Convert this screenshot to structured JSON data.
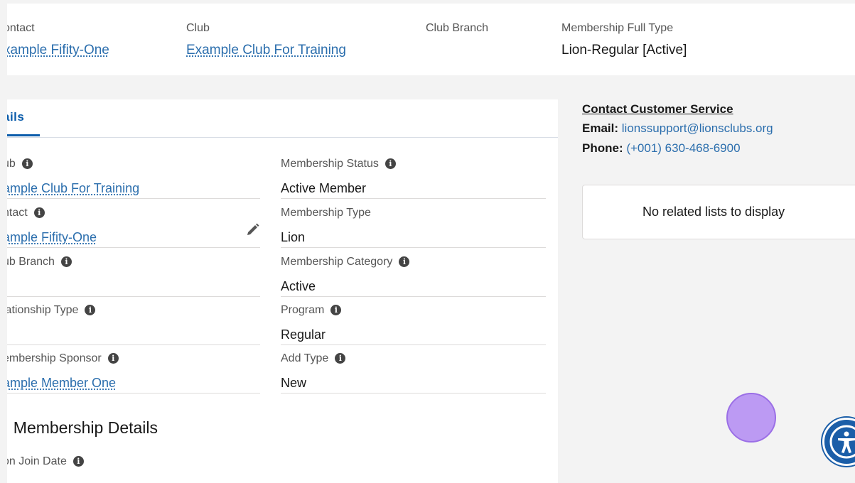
{
  "header": {
    "contact_label": "ontact",
    "contact_value": "xample Fifity-One",
    "club_label": "Club",
    "club_value": "Example Club For Training",
    "branch_label": "Club Branch",
    "fulltype_label": "Membership Full Type",
    "fulltype_value": "Lion-Regular [Active]"
  },
  "tabs": {
    "details": "ails"
  },
  "left_fields": [
    {
      "label": "ub",
      "value": "ample Club For Training",
      "has_info": true
    },
    {
      "label": "ntact",
      "value": "ample Fifity-One",
      "has_info": true
    },
    {
      "label": "ub Branch",
      "value": "",
      "has_info": true
    },
    {
      "label": "lationship Type",
      "value": "",
      "has_info": true
    },
    {
      "label": "embership Sponsor",
      "value": "ample Member One",
      "has_info": true
    }
  ],
  "right_fields": [
    {
      "label": "Membership Status",
      "value": "Active Member",
      "has_info": true
    },
    {
      "label": "Membership Type",
      "value": "Lion",
      "has_info": false
    },
    {
      "label": "Membership Category",
      "value": "Active",
      "has_info": true
    },
    {
      "label": "Program",
      "value": "Regular",
      "has_info": true
    },
    {
      "label": "Add Type",
      "value": "New",
      "has_info": true
    }
  ],
  "section": {
    "title": "Membership Details",
    "join_date_label": "on Join Date"
  },
  "sidebar": {
    "title": "Contact Customer Service",
    "email_label": "Email:",
    "email_value": "lionssupport@lionsclubs.org",
    "phone_label": "Phone:",
    "phone_value": "(+001) 630-468-6900",
    "related_empty": "No related lists to display"
  },
  "icons": {
    "info": "info-icon",
    "edit": "pencil-icon",
    "accessibility": "accessibility-icon"
  },
  "colors": {
    "link": "#2b6ead",
    "tab_active": "#0b5cab",
    "background": "#f3f3f3",
    "accessibility_button": "#1b5ea8",
    "cursor_marker": "#b28af2"
  }
}
